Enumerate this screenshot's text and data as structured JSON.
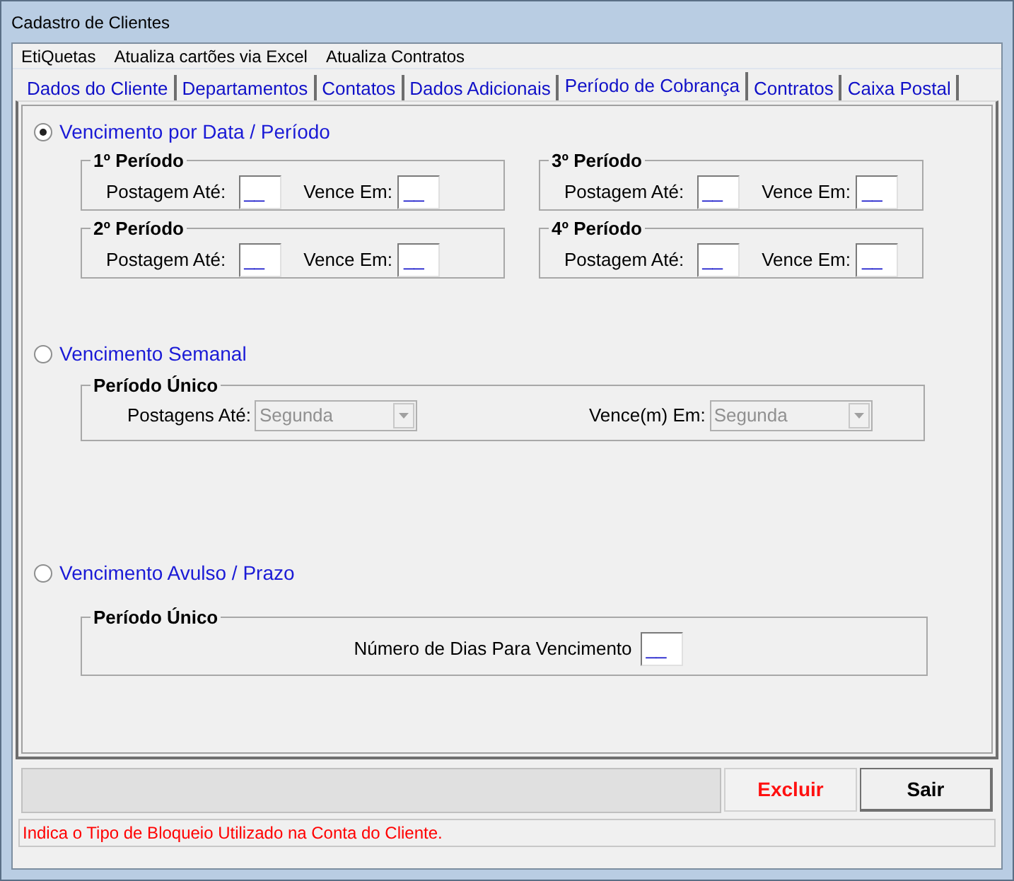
{
  "window": {
    "title": "Cadastro de Clientes"
  },
  "menu": [
    {
      "label": "EtiQuetas"
    },
    {
      "label": "Atualiza cartões via Excel"
    },
    {
      "label": "Atualiza Contratos"
    }
  ],
  "tabs": [
    {
      "label": "Dados do Cliente",
      "selected": false
    },
    {
      "label": "Departamentos",
      "selected": false
    },
    {
      "label": "Contatos",
      "selected": false
    },
    {
      "label": "Dados Adicionais",
      "selected": false
    },
    {
      "label": "Período de Cobrança",
      "selected": true
    },
    {
      "label": "Contratos",
      "selected": false
    },
    {
      "label": "Caixa Postal",
      "selected": false
    }
  ],
  "sections": [
    {
      "kind": "periods",
      "label": "Vencimento por Data / Período",
      "selected": true,
      "groups": [
        {
          "title": "1º Período",
          "fields": [
            {
              "label": "Postagem Até:",
              "value": "__"
            },
            {
              "label": "Vence Em:",
              "value": "__"
            }
          ]
        },
        {
          "title": "3º Período",
          "fields": [
            {
              "label": "Postagem Até:",
              "value": "__"
            },
            {
              "label": "Vence Em:",
              "value": "__"
            }
          ]
        },
        {
          "title": "2º Período",
          "fields": [
            {
              "label": "Postagem Até:",
              "value": "__"
            },
            {
              "label": "Vence Em:",
              "value": "__"
            }
          ]
        },
        {
          "title": "4º Período",
          "fields": [
            {
              "label": "Postagem Até:",
              "value": "__"
            },
            {
              "label": "Vence Em:",
              "value": "__"
            }
          ]
        }
      ]
    },
    {
      "kind": "weekly",
      "label": "Vencimento Semanal",
      "selected": false,
      "group": {
        "title": "Período Único",
        "fields": [
          {
            "label": "Postagens Até:",
            "value": "Segunda",
            "disabled": true
          },
          {
            "label": "Vence(m) Em:",
            "value": "Segunda",
            "disabled": true
          }
        ]
      }
    },
    {
      "kind": "days",
      "label": "Vencimento Avulso / Prazo",
      "selected": false,
      "group": {
        "title": "Período Único",
        "fields": [
          {
            "label": "Número de Dias Para Vencimento",
            "value": "__"
          }
        ]
      }
    }
  ],
  "buttons": [
    {
      "label": "Excluir",
      "kind": "danger"
    },
    {
      "label": "Sair",
      "kind": "normal"
    }
  ],
  "status_bar": {
    "text": "Indica o Tipo de Bloqueio Utilizado na Conta do Cliente."
  }
}
